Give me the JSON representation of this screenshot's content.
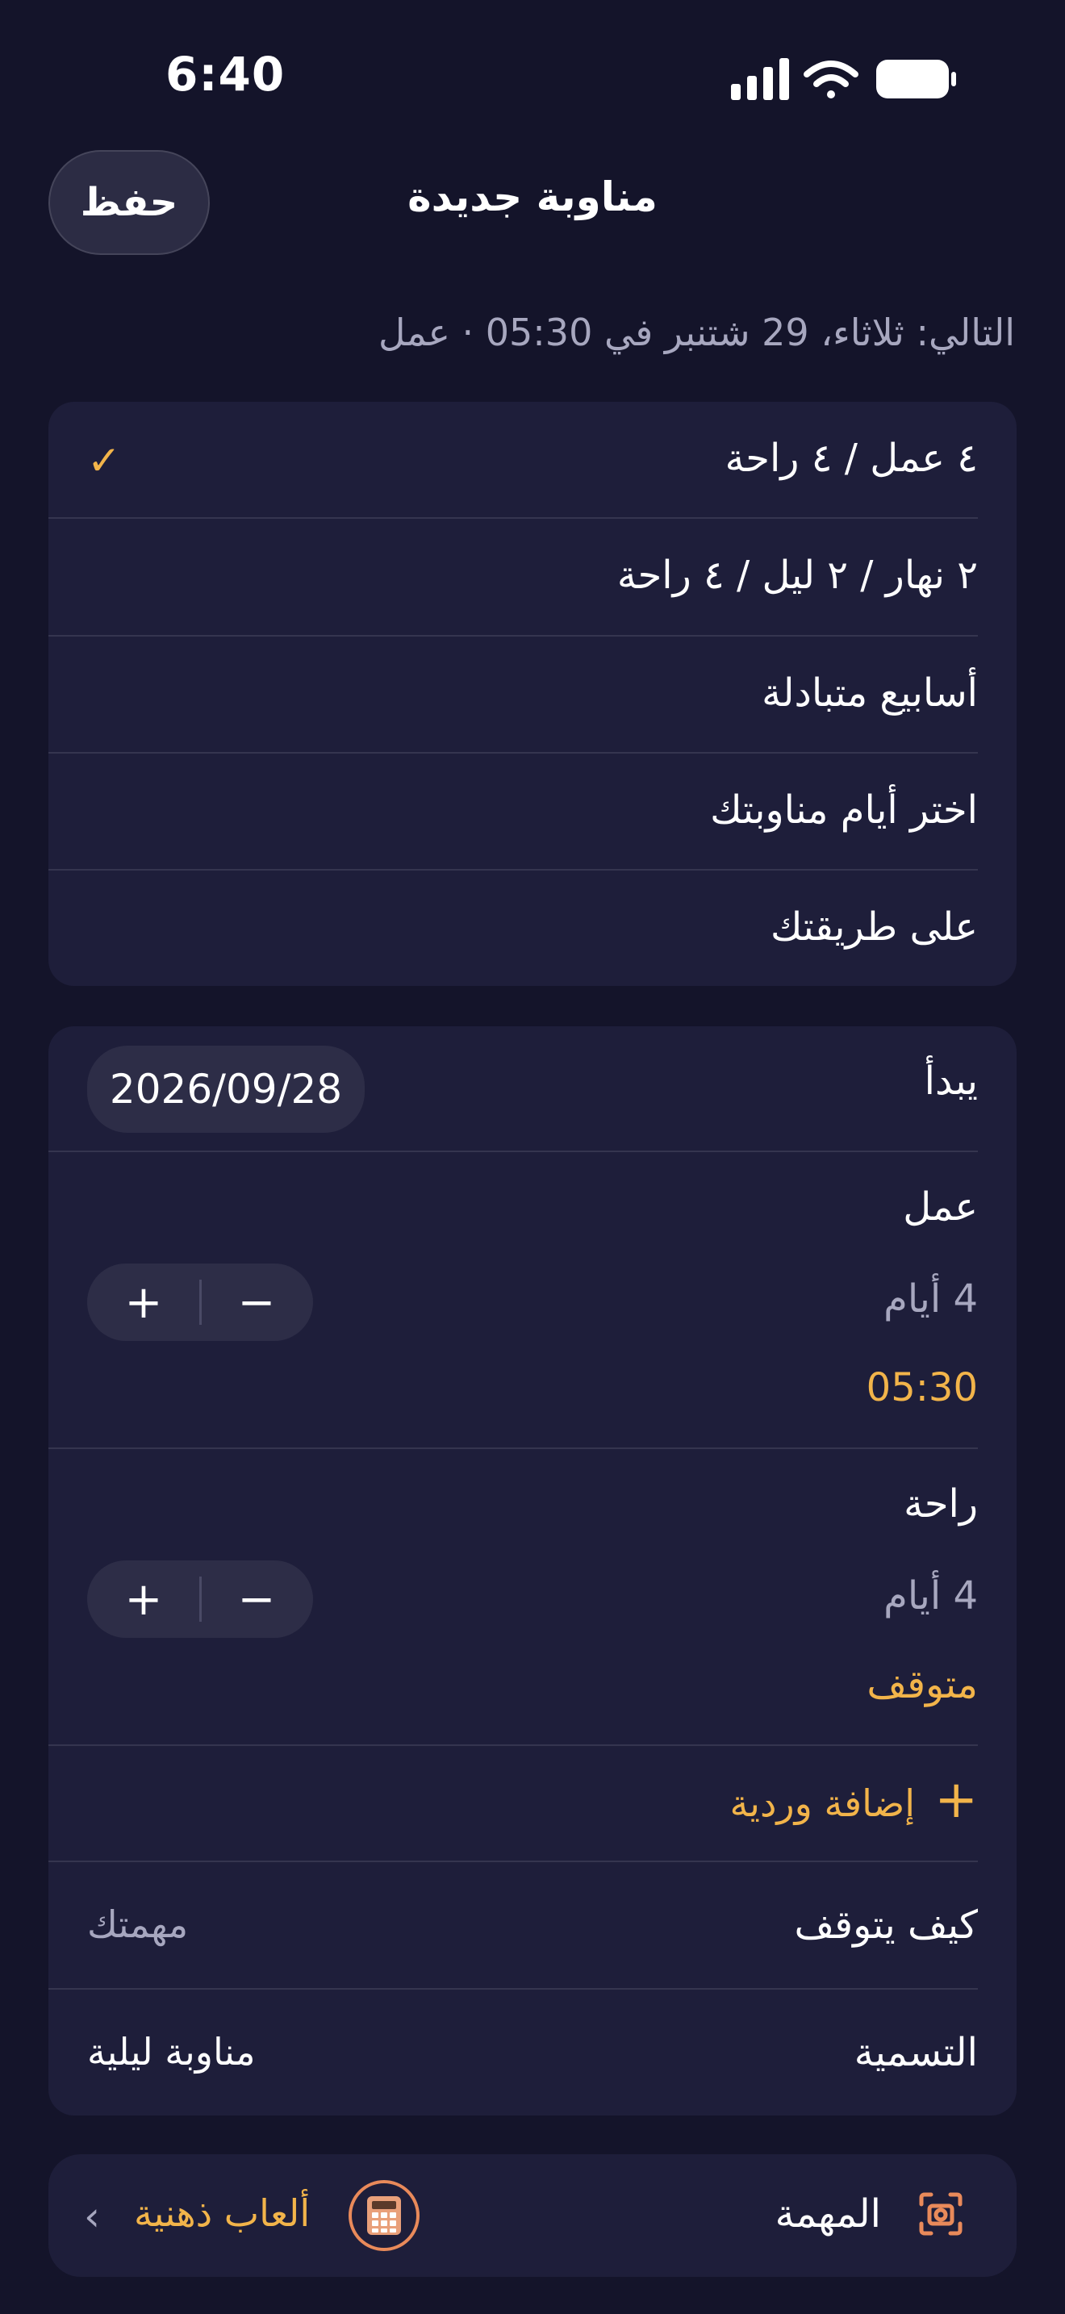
{
  "status": {
    "time": "6:40"
  },
  "header": {
    "save_label": "حفظ",
    "title": "مناوبة جديدة"
  },
  "next_info": "التالي: ثلاثاء، 29 شتنبر في 05:30 · عمل",
  "patterns": [
    {
      "label": "٤ عمل / ٤ راحة",
      "selected": true
    },
    {
      "label": "٢ نهار / ٢ ليل / ٤ راحة",
      "selected": false
    },
    {
      "label": "أسابيع متبادلة",
      "selected": false
    },
    {
      "label": "اختر أيام مناوبتك",
      "selected": false
    },
    {
      "label": "على طريقتك",
      "selected": false
    }
  ],
  "check_mark": "✓",
  "settings": {
    "start_label": "يبدأ",
    "start_date": "2026/09/28",
    "work": {
      "title": "عمل",
      "days": "4 أيام",
      "time": "05:30"
    },
    "rest": {
      "title": "راحة",
      "days": "4 أيام",
      "time": "متوقف"
    },
    "stepper_plus": "+",
    "stepper_minus": "−",
    "add_shift_label": "إضافة وردية",
    "add_icon": "+",
    "how_stops_label": "كيف يتوقف",
    "how_stops_value": "مهمتك",
    "name_label": "التسمية",
    "name_value": "مناوبة ليلية"
  },
  "task": {
    "label": "المهمة",
    "value": "ألعاب ذهنية",
    "chevron": "‹"
  },
  "colors": {
    "accent": "#f2b44a",
    "background": "#14142a",
    "card": "#1e1e3a",
    "icon_orange": "#e98a5a"
  },
  "icons": {
    "task_icon": "camera-scan-icon",
    "value_icon": "calculator-icon"
  }
}
